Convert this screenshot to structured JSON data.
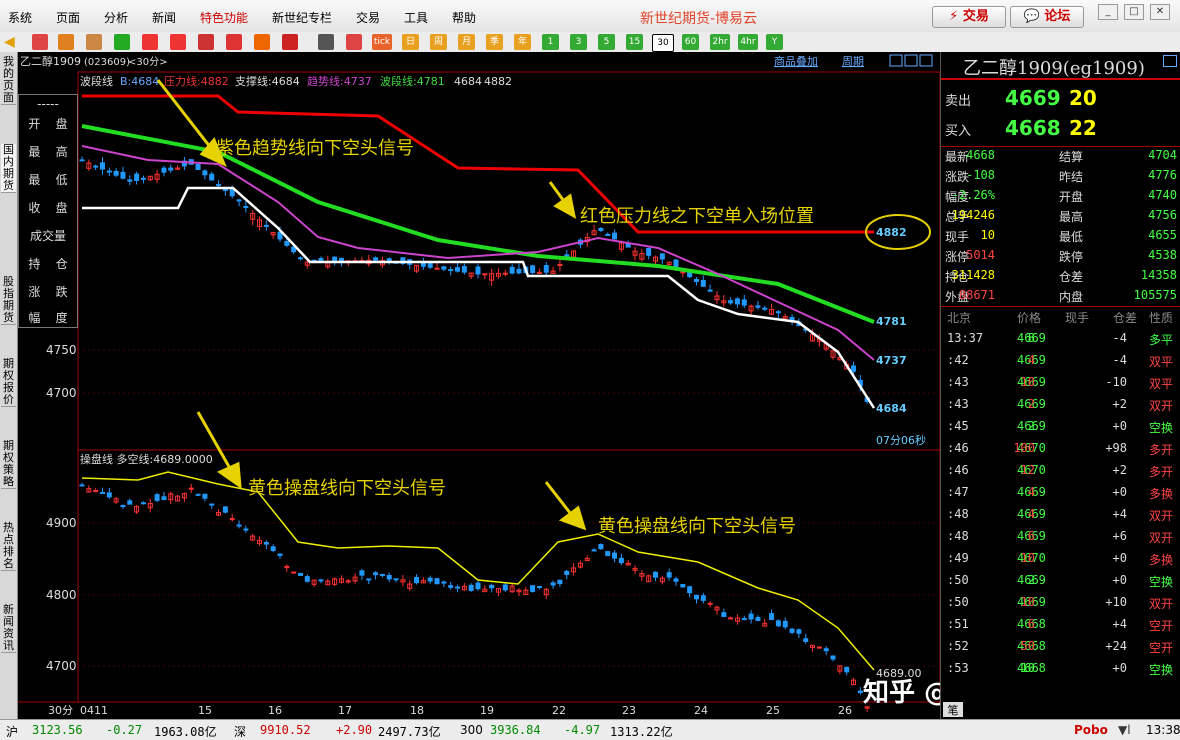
{
  "menu": [
    "系统",
    "页面",
    "分析",
    "新闻",
    "特色功能",
    "新世纪专栏",
    "交易",
    "工具",
    "帮助"
  ],
  "app_title": "新世纪期货-博易云",
  "top_buttons": {
    "trade": "交易",
    "forum": "论坛"
  },
  "toolbar_periods": [
    "日",
    "周",
    "月",
    "季",
    "年",
    "1",
    "3",
    "5",
    "15",
    "30",
    "60",
    "2hr",
    "4hr",
    "Y"
  ],
  "toolbar_tick": "tick",
  "left_tabs": [
    "我的页面",
    "国内期货",
    "股指期货",
    "期权报价",
    "期权策略",
    "热点排名",
    "新闻资讯"
  ],
  "chart_header": {
    "symbol": "乙二醇1909",
    "code": "(023609)",
    "period": "<30分>",
    "overlay_link": "商品叠加",
    "period_link": "周期"
  },
  "indicator_legend": {
    "name": "波段线",
    "b": "B:4684",
    "pressure": "压力线:4882",
    "support": "支撑线:4684",
    "trend": "趋势线:4737",
    "wave": "波段线:4781",
    "v1": "4684",
    "v2": "4882"
  },
  "info_panel": [
    "-----",
    "开",
    "盘",
    "最",
    "高",
    "最",
    "低",
    "收",
    "盘",
    "成交量",
    "持",
    "仓",
    "涨",
    "跌",
    "幅",
    "度"
  ],
  "price_axis_main": [
    "4750",
    "4700"
  ],
  "price_axis_sub": [
    "4900",
    "4800",
    "4700"
  ],
  "value_labels": {
    "pressure": "4882",
    "wave": "4781",
    "trend": "4737",
    "last": "4684",
    "timer": "07分06秒",
    "sub_last": "4689.00"
  },
  "sub_legend": "操盘线  多空线:4689.0000",
  "x_axis": {
    "corner": "30分",
    "labels": [
      "0411",
      "15",
      "16",
      "17",
      "18",
      "19",
      "22",
      "23",
      "24",
      "25",
      "26"
    ]
  },
  "annotations": {
    "a1": "紫色趋势线向下空头信号",
    "a2": "红色压力线之下空单入场位置",
    "a3": "黄色操盘线向下空头信号",
    "a4": "黄色操盘线向下空头信号"
  },
  "watermark": "知乎 @期货女达人",
  "quote": {
    "title": "乙二醇1909(eg1909)",
    "sell_label": "卖出",
    "sell_price": "4669",
    "sell_vol": "20",
    "buy_label": "买入",
    "buy_price": "4668",
    "buy_vol": "22",
    "rows": [
      [
        "最新",
        "4668",
        "结算",
        "4704"
      ],
      [
        "涨跌",
        "-108",
        "昨结",
        "4776"
      ],
      [
        "幅度",
        "-2.26%",
        "开盘",
        "4740"
      ],
      [
        "总手",
        "194246",
        "最高",
        "4756"
      ],
      [
        "现手",
        "10",
        "最低",
        "4655"
      ],
      [
        "涨停",
        "5014",
        "跌停",
        "4538"
      ],
      [
        "持仓",
        "311428",
        "仓差",
        "14358"
      ],
      [
        "外盘",
        "88671",
        "内盘",
        "105575"
      ]
    ],
    "tick_header": [
      "北京",
      "价格",
      "现手",
      "仓差",
      "性质"
    ],
    "ticks": [
      [
        "13:37",
        "4669",
        "8",
        "-4",
        "多平"
      ],
      [
        ":42",
        "4669",
        "4",
        "-4",
        "双平"
      ],
      [
        ":43",
        "4669",
        "10",
        "-10",
        "双平"
      ],
      [
        ":43",
        "4669",
        "2",
        "+2",
        "双开"
      ],
      [
        ":45",
        "4669",
        "2",
        "+0",
        "空换"
      ],
      [
        ":46",
        "4670",
        "100",
        "+98",
        "多开"
      ],
      [
        ":46",
        "4670",
        "12",
        "+2",
        "多开"
      ],
      [
        ":47",
        "4669",
        "4",
        "+0",
        "多换"
      ],
      [
        ":48",
        "4669",
        "4",
        "+4",
        "双开"
      ],
      [
        ":48",
        "4669",
        "6",
        "+6",
        "双开"
      ],
      [
        ":49",
        "4670",
        "10",
        "+0",
        "多换"
      ],
      [
        ":50",
        "4669",
        "2",
        "+0",
        "空换"
      ],
      [
        ":50",
        "4669",
        "10",
        "+10",
        "双开"
      ],
      [
        ":51",
        "4668",
        "6",
        "+4",
        "空开"
      ],
      [
        ":52",
        "4668",
        "50",
        "+24",
        "空开"
      ],
      [
        ":53",
        "4668",
        "10",
        "+0",
        "空换"
      ]
    ],
    "bottom_tab": "笔"
  },
  "status": {
    "sh_label": "沪",
    "sh_val": "3123.56",
    "sh_chg": "-0.27",
    "sh_amt": "1963.08亿",
    "sz_label": "深",
    "sz_val": "9910.52",
    "sz_chg": "+2.90",
    "sz_amt": "2497.73亿",
    "i300_label": "300",
    "i300_val": "3936.84",
    "i300_chg": "-4.97",
    "i300_amt": "1313.22亿",
    "brand": "Pobo",
    "time": "13:38"
  }
}
